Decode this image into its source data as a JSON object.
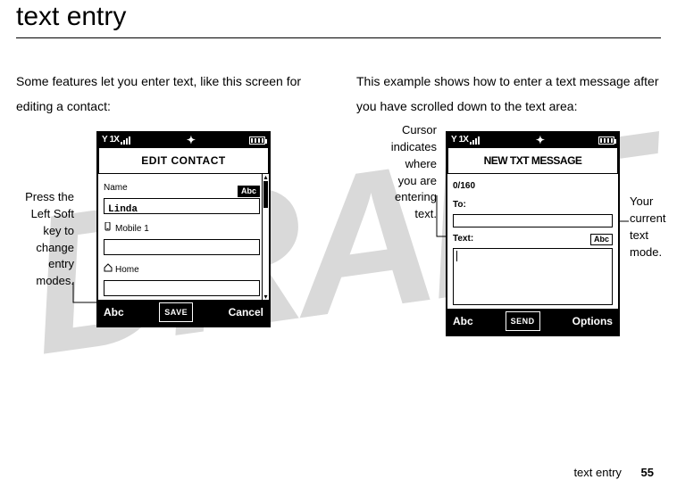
{
  "page": {
    "title": "text entry",
    "footer_label": "text entry",
    "page_number": "55"
  },
  "left": {
    "intro": "Some features let you enter text, like this screen for editing a contact:",
    "callout": "Press the\nLeft Soft\nkey to\nchange\nentry\nmodes.",
    "phone": {
      "status_1x": "1X",
      "title": "EDIT CONTACT",
      "name_label": "Name",
      "name_value": "Linda",
      "mode_chip": "Abc",
      "mobile_label": "Mobile 1",
      "home_label": "Home",
      "soft_left": "Abc",
      "soft_center": "SAVE",
      "soft_right": "Cancel"
    }
  },
  "right": {
    "intro": "This example shows how to enter a text message after you have scrolled down to the text area:",
    "callout_left": "Cursor\nindicates\nwhere\nyou are\nentering\ntext.",
    "callout_right": "Your\ncurrent\ntext\nmode.",
    "phone": {
      "status_1x": "1X",
      "title": "NEW TXT MESSAGE",
      "counter": "0/160",
      "to_label": "To:",
      "text_label": "Text:",
      "mode_chip": "Abc",
      "soft_left": "Abc",
      "soft_center": "SEND",
      "soft_right": "Options"
    }
  }
}
